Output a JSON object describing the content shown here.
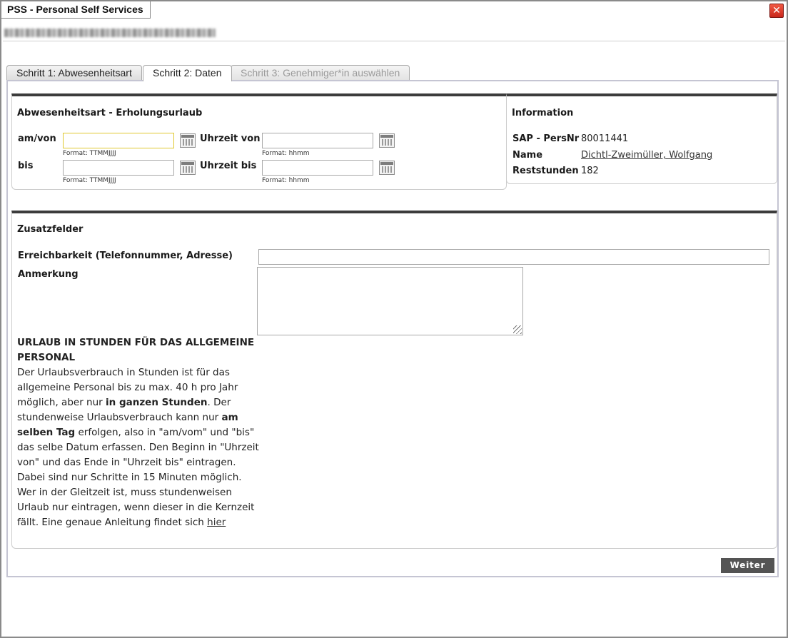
{
  "window": {
    "title": "PSS - Personal Self Services",
    "close_symbol": "✕"
  },
  "tabs": [
    {
      "label": "Schritt 1: Abwesenheitsart",
      "state": "normal"
    },
    {
      "label": "Schritt 2: Daten",
      "state": "active"
    },
    {
      "label": "Schritt 3: Genehmiger*in auswählen",
      "state": "disabled"
    }
  ],
  "absence": {
    "title": "Abwesenheitsart - Erholungsurlaub",
    "from_label": "am/von",
    "from_value": "",
    "from_hint": "Format: TTMMJJJJ",
    "to_label": "bis",
    "to_value": "",
    "to_hint": "Format: TTMMJJJJ",
    "time_from_label": "Uhrzeit von",
    "time_from_value": "",
    "time_from_hint": "Format: hhmm",
    "time_to_label": "Uhrzeit bis",
    "time_to_value": "",
    "time_to_hint": "Format: hhmm",
    "calendar_icon": "calendar-icon"
  },
  "information": {
    "title": "Information",
    "persnr_label": "SAP - PersNr",
    "persnr_value": "80011441",
    "name_label": "Name",
    "name_value": "Dichtl-Zweimüller, Wolfgang",
    "hours_label": "Reststunden",
    "hours_value": "182"
  },
  "extra": {
    "title": "Zusatzfelder",
    "reach_label": "Erreichbarkeit (Telefonnummer, Adresse)",
    "reach_value": "",
    "remark_label": "Anmerkung",
    "remark_value": "",
    "info_heading": "URLAUB IN STUNDEN FÜR DAS ALLGEMEINE PERSONAL",
    "info_p1": "Der Urlaubsverbrauch in Stunden ist für das allgemeine Personal bis zu max. 40 h pro Jahr möglich, aber nur ",
    "info_b1": "in ganzen Stunden",
    "info_p2": ". Der stundenweise Urlaubsverbrauch kann nur ",
    "info_b2": "am selben Tag",
    "info_p3": " erfolgen, also in \"am/vom\" und \"bis\" das selbe Datum erfassen. Den Beginn in \"Uhrzeit von\" und das Ende in \"Uhrzeit bis\" eintragen. Dabei sind nur Schritte in 15 Minuten möglich. Wer in der Gleitzeit ist, muss stundenweisen Urlaub nur eintragen, wenn dieser in die Kernzeit fällt. Eine genaue Anleitung findet sich ",
    "info_link": "hier"
  },
  "actions": {
    "next_label": "Weiter"
  }
}
